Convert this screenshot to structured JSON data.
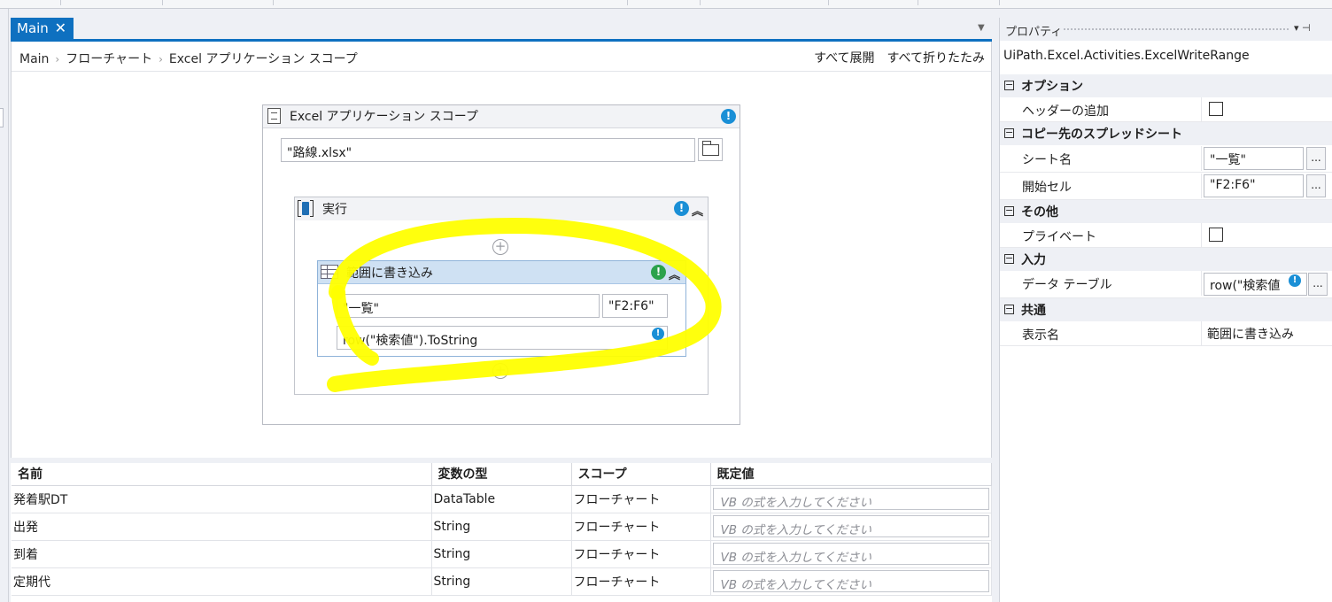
{
  "tab": {
    "label": "Main",
    "close": "✕"
  },
  "breadcrumb": {
    "items": [
      "Main",
      "フローチャート",
      "Excel アプリケーション スコープ"
    ],
    "sep": "›"
  },
  "breadcrumb_actions": {
    "expand_all": "すべて展開",
    "collapse_all": "すべて折りたたみ"
  },
  "scope": {
    "title": "Excel アプリケーション スコープ",
    "workbook_path": "\"路線.xlsx\""
  },
  "do_block": {
    "title": "実行",
    "collapse": "︽"
  },
  "write_range": {
    "title": "範囲に書き込み",
    "sheet": "\"一覧\"",
    "range": "\"F2:F6\"",
    "datatable": "row(\"検索値\").ToString",
    "collapse": "︽"
  },
  "add_symbol": "+",
  "variables": {
    "headers": [
      "名前",
      "変数の型",
      "スコープ",
      "既定値"
    ],
    "default_placeholder": "VB の式を入力してください",
    "rows": [
      {
        "name": "発着駅DT",
        "type": "DataTable",
        "scope": "フローチャート"
      },
      {
        "name": "出発",
        "type": "String",
        "scope": "フローチャート"
      },
      {
        "name": "到着",
        "type": "String",
        "scope": "フローチャート"
      },
      {
        "name": "定期代",
        "type": "String",
        "scope": "フローチャート"
      }
    ]
  },
  "properties": {
    "title": "プロパティ",
    "pin": "▾ ⊣",
    "type_name": "UiPath.Excel.Activities.ExcelWriteRange",
    "collapse_symbol": "−",
    "categories": {
      "options": "オプション",
      "destination": "コピー先のスプレッドシート",
      "misc": "その他",
      "input": "入力",
      "common": "共通"
    },
    "fields": {
      "add_headers": "ヘッダーの追加",
      "sheet_name": "シート名",
      "sheet_name_value": "\"一覧\"",
      "start_cell": "開始セル",
      "start_cell_value": "\"F2:F6\"",
      "private": "プライベート",
      "datatable": "データ テーブル",
      "datatable_value": "row(\"検索値",
      "display_name": "表示名",
      "display_name_value": "範囲に書き込み"
    },
    "ellipsis": "..."
  },
  "colors": {
    "accent": "#0e70c0",
    "highlighter": "#ffff00",
    "info": "#1a8fd6",
    "warn_green": "#2ba24c"
  }
}
